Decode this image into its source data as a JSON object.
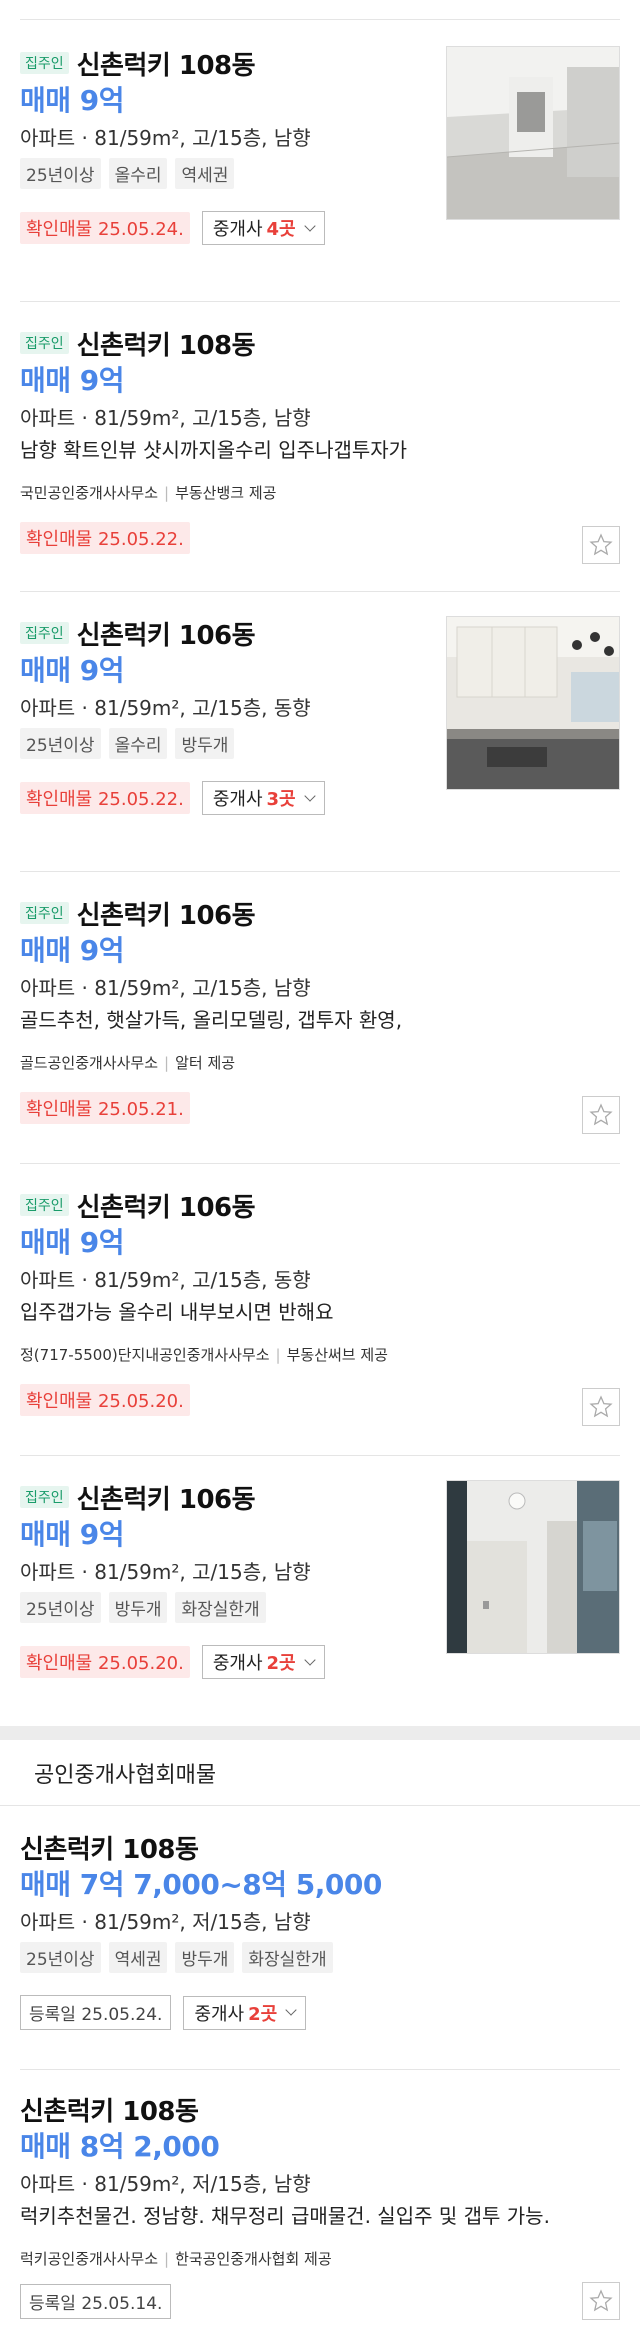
{
  "listings": [
    {
      "owner_badge": "집주인",
      "title": "신촌럭키 108동",
      "price": "매매 9억",
      "spec": "아파트 · 81/59m², 고/15층, 남향",
      "tags": [
        "25년이상",
        "올수리",
        "역세권"
      ],
      "confirm": "확인매물 25.05.24.",
      "broker_label": "중개사",
      "broker_count": "4곳"
    },
    {
      "owner_badge": "집주인",
      "title": "신촌럭키 108동",
      "price": "매매 9억",
      "spec": "아파트 · 81/59m², 고/15층, 남향",
      "desc": "남향 확트인뷰 샷시까지올수리 입주나갭투자가",
      "agency": "국민공인중개사사무소",
      "provider": "부동산뱅크 제공",
      "confirm": "확인매물 25.05.22."
    },
    {
      "owner_badge": "집주인",
      "title": "신촌럭키 106동",
      "price": "매매 9억",
      "spec": "아파트 · 81/59m², 고/15층, 동향",
      "tags": [
        "25년이상",
        "올수리",
        "방두개"
      ],
      "confirm": "확인매물 25.05.22.",
      "broker_label": "중개사",
      "broker_count": "3곳"
    },
    {
      "owner_badge": "집주인",
      "title": "신촌럭키 106동",
      "price": "매매 9억",
      "spec": "아파트 · 81/59m², 고/15층, 남향",
      "desc": "골드추천, 햇살가득, 올리모델링, 갭투자 환영,",
      "agency": "골드공인중개사사무소",
      "provider": "알터 제공",
      "confirm": "확인매물 25.05.21."
    },
    {
      "owner_badge": "집주인",
      "title": "신촌럭키 106동",
      "price": "매매 9억",
      "spec": "아파트 · 81/59m², 고/15층, 동향",
      "desc": "입주갭가능 올수리 내부보시면 반해요",
      "agency": "정(717-5500)단지내공인중개사사무소",
      "provider": "부동산써브 제공",
      "confirm": "확인매물 25.05.20."
    },
    {
      "owner_badge": "집주인",
      "title": "신촌럭키 106동",
      "price": "매매 9억",
      "spec": "아파트 · 81/59m², 고/15층, 남향",
      "tags": [
        "25년이상",
        "방두개",
        "화장실한개"
      ],
      "confirm": "확인매물 25.05.20.",
      "broker_label": "중개사",
      "broker_count": "2곳"
    }
  ],
  "section2": {
    "title": "공인중개사협회매물",
    "listings": [
      {
        "title": "신촌럭키 108동",
        "price": "매매 7억 7,000~8억 5,000",
        "spec": "아파트 · 81/59m², 저/15층, 남향",
        "tags": [
          "25년이상",
          "역세권",
          "방두개",
          "화장실한개"
        ],
        "regdate": "등록일 25.05.24.",
        "broker_label": "중개사",
        "broker_count": "2곳"
      },
      {
        "title": "신촌럭키 108동",
        "price": "매매 8억 2,000",
        "spec": "아파트 · 81/59m², 저/15층, 남향",
        "desc": "럭키추천물건. 정남향. 채무정리 급매물건. 실입주 및 갭투 가능.",
        "agency": "럭키공인중개사사무소",
        "provider": "한국공인중개사협회 제공",
        "regdate": "등록일 25.05.14."
      }
    ]
  },
  "icons": {
    "star": "star-outline-icon",
    "chevron": "chevron-down-icon"
  },
  "colors": {
    "price": "#4a86e8",
    "confirm": "#e8403a",
    "owner_badge": "#1a9c6a"
  }
}
